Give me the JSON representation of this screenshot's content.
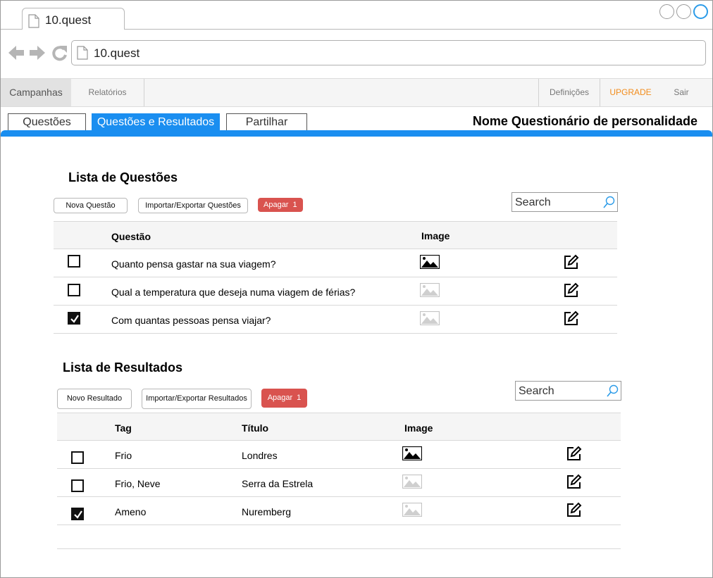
{
  "browser": {
    "tab_title": "10.quest",
    "address": "10.quest"
  },
  "menubar": {
    "left": [
      "Campanhas",
      "Relatórios"
    ],
    "right": [
      "Definições",
      "UPGRADE",
      "Sair"
    ],
    "upgrade_color": "#f28c1b"
  },
  "content_tabs": [
    "Questões",
    "Questões e Resultados",
    "Partilhar"
  ],
  "active_tab": "Questões e Resultados",
  "survey_name": "Nome Questionário de personalidade",
  "accent_color": "#1a8ef0",
  "questions": {
    "title": "Lista de Questões",
    "new_label": "Nova Questão",
    "import_label": "Importar/Exportar Questões",
    "delete_label": "Apagar",
    "delete_count": "1",
    "search_placeholder": "Search",
    "headers": [
      "Questão",
      "Image"
    ],
    "rows": [
      {
        "checked": false,
        "text": "Quanto pensa gastar na sua viagem?",
        "image": "image-filled-icon"
      },
      {
        "checked": false,
        "text": "Qual a temperatura que deseja numa viagem de férias?",
        "image": "image-placeholder-icon"
      },
      {
        "checked": true,
        "text": "Com quantas pessoas pensa viajar?",
        "image": "image-placeholder-icon"
      }
    ]
  },
  "results": {
    "title": "Lista de Resultados",
    "new_label": "Novo Resultado",
    "import_label": "Importar/Exportar Resultados",
    "delete_label": "Apagar",
    "delete_count": "1",
    "search_placeholder": "Search",
    "headers": [
      "Tag",
      "Título",
      "Image"
    ],
    "rows": [
      {
        "checked": false,
        "tag": "Frio",
        "title": "Londres",
        "image": "image-filled-icon"
      },
      {
        "checked": false,
        "tag": "Frio, Neve",
        "title": "Serra da Estrela",
        "image": "image-placeholder-icon"
      },
      {
        "checked": true,
        "tag": "Ameno",
        "title": "Nuremberg",
        "image": "image-placeholder-icon"
      }
    ]
  },
  "danger_color": "#d9534f"
}
